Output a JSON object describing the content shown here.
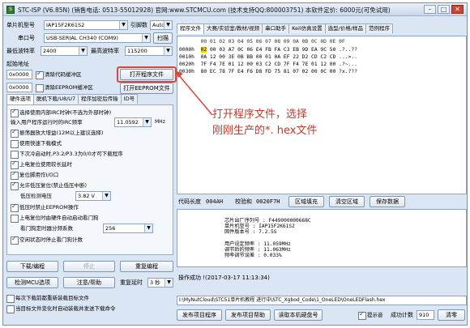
{
  "window": {
    "title": "STC-ISP (V6.85N) (销售电话: 0513-55012928) 官网:www.STCMCU.com (技术支持QQ:800003751) 本软件定价: 6000元(可免试用)",
    "icon_name": "stc-app-icon",
    "controls": [
      "–",
      "□",
      "✕"
    ]
  },
  "left": {
    "mcu_type_label": "单片机型号",
    "mcu_type_value": "IAP15F2K61S2",
    "pin_label": "引脚数",
    "pin_value": "Auto",
    "port_label": "串口号",
    "port_value": "USB-SERIAL CH340 (COM9)",
    "scan_label": "扫描",
    "min_baud_label": "最低波特率",
    "min_baud_value": "2400",
    "max_baud_label": "最高波特率",
    "max_baud_value": "115200",
    "start_addr_label": "起始地址",
    "addr1": "0x0000",
    "clear_code_label": "清除代码缓冲区",
    "open_program_label": "打开程序文件",
    "addr2": "0x0000",
    "clear_eeprom_label": "清除EEPROM缓冲区",
    "open_eeprom_label": "打开EEPROM文件",
    "tabs": [
      "硬件选项",
      "脱机下载/U8/U7",
      "程序加密后传输",
      "ID号"
    ],
    "options": [
      {
        "label": "选择使用内部IRC时钟(不选为外部时钟)",
        "checked": true
      },
      {
        "label": "输入用户程序运行时的IRC频率",
        "value": "11.0592",
        "unit": "MHz"
      },
      {
        "label": "振荡器放大增益(12M以上建议选择)",
        "checked": true
      },
      {
        "label": "使用快速下载模式",
        "checked": false
      },
      {
        "label": "下次冷启动时,P3.2/P3.3为0/0才可下载程序",
        "checked": false
      },
      {
        "label": "上电复位使用较长延时",
        "checked": true
      },
      {
        "label": "复位脚用作I/O口",
        "checked": true
      },
      {
        "label": "允许低压复位(禁止低压中断)",
        "checked": true
      },
      {
        "label": "低压检测电压",
        "value": "3.82 V"
      },
      {
        "label": "低压时禁止EEPROM操作",
        "checked": true
      },
      {
        "label": "上电复位时由硬件自动启动看门狗",
        "checked": false
      },
      {
        "label": "看门狗定时器分频系数",
        "value": "256"
      },
      {
        "label": "空闲状态时停止看门狗计数",
        "checked": true
      }
    ],
    "download_label": "下载/编程",
    "stop_label": "停止",
    "reprogram_label": "重复编程",
    "detect_label": "检测MCU选项",
    "help_label": "注意/帮助",
    "repeat_delay_label": "重复延时",
    "repeat_delay_value": "3 秒",
    "reload_label": "每次下载前都重新装载目标文件",
    "auto_send_label": "当目标文件变化时自动装载并发送下载命令"
  },
  "right": {
    "tabs": [
      "程序文件",
      "大赛/实验室/教材/视频",
      "串口助手",
      "Keil仿真设置",
      "选型/价格/样品",
      "范例程序"
    ],
    "hex_header": "       00 01 02 03 04 05 06 07 08 09 0A 0B 0C 0D 0E 0F",
    "hex_rows": [
      {
        "addr": "0000h",
        "first": "02",
        "bytes": " 00 03 A7 0C 06 E4 FB FA C3 EB 9D EA 9C 50",
        "ascii": " .?..??"
      },
      {
        "addr": "0010h",
        "first": "",
        "bytes": "0A 12 00 3E 0B BB 00 01 0A EF 22 D2 CD C2 CD",
        "ascii": " ...>.."
      },
      {
        "addr": "0020h",
        "first": "",
        "bytes": "7F F4 7E 01 12 00 03 C2 CD 7F F4 7E 01 12 00",
        "ascii": " .?~..."
      },
      {
        "addr": "0030h",
        "first": "",
        "bytes": "80 EC 78 7F E4 F6 D8 FD 75 81 07 02 00 0C 00",
        "ascii": " ?x.???"
      }
    ],
    "code_size_label": "代码长度",
    "code_size_value": "004AH",
    "checksum_label": "校验和",
    "checksum_value": "0020F7H",
    "fill_label": "区域填充",
    "clear_label": "清空区域",
    "save_label": "保存数据",
    "info_lines": [
      "芯片出厂序列号 : F449000000668C",
      "单片机型号 : IAP15F2K61S2",
      "固件版本号 : 7.2.5S",
      "",
      "用户设定频率 : 11.059MHz",
      "调节后的频率 : 11.063MHz",
      "频率调节误差 : 0.033%"
    ],
    "status_line": "操作成功 !(2017-03-17 11:13:34)",
    "path_line": "I:\\MyNutCloud\\STC51单片机教程 进行中\\STC_Xgbod_Code\\1_OneLED\\OneLEDFlash.hex",
    "publish_program_label": "发布项目程序",
    "publish_help_label": "发布项目帮助",
    "read_serial_label": "读取本机硬盘号",
    "sound_label": "提示音",
    "success_count_label": "成功计数",
    "success_count_value": "910",
    "clear_count_label": "清零"
  },
  "annotation": {
    "text_line1": "打开程序文件，选择",
    "text_line2": "刚刚生产的*. hex文件",
    "color": "#c0392b"
  }
}
